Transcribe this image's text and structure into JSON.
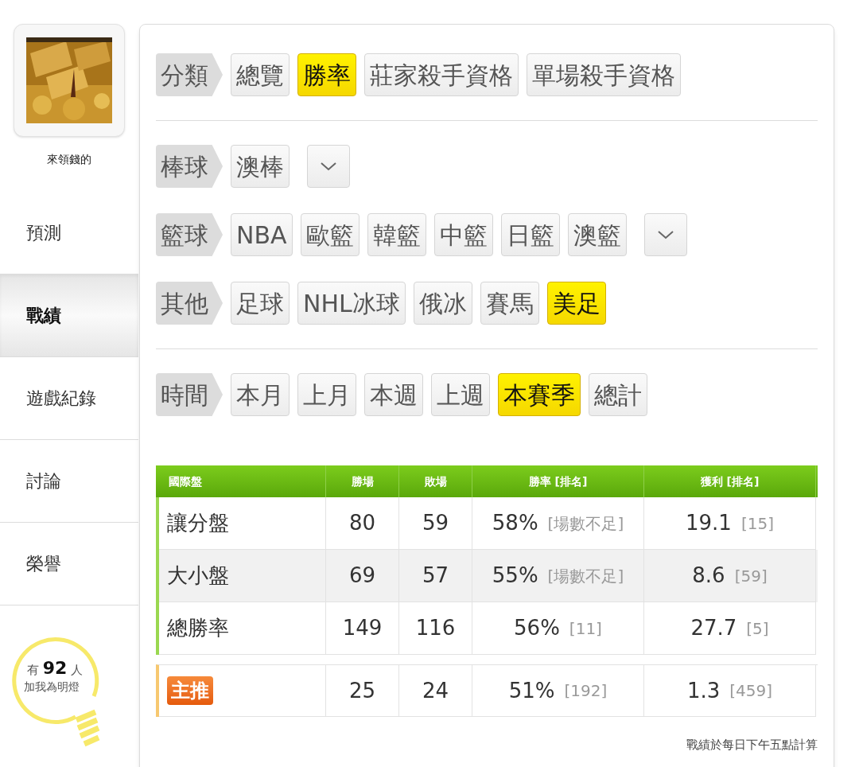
{
  "sidebar": {
    "profile_name": "來領錢的",
    "items": [
      {
        "label": "預測",
        "selected": false
      },
      {
        "label": "戰績",
        "selected": true
      },
      {
        "label": "遊戲紀錄",
        "selected": false
      },
      {
        "label": "討論",
        "selected": false
      },
      {
        "label": "榮譽",
        "selected": false
      }
    ],
    "fans": {
      "prefix": "有",
      "count": "92",
      "suffix": "人",
      "caption": "加我為明燈"
    }
  },
  "filters": [
    {
      "label": "分類",
      "divider_after": true,
      "has_more": false,
      "options": [
        {
          "label": "總覽",
          "selected": false
        },
        {
          "label": "勝率",
          "selected": true
        },
        {
          "label": "莊家殺手資格",
          "selected": false
        },
        {
          "label": "單場殺手資格",
          "selected": false
        }
      ]
    },
    {
      "label": "棒球",
      "divider_after": false,
      "has_more": true,
      "options": [
        {
          "label": "澳棒",
          "selected": false
        }
      ]
    },
    {
      "label": "籃球",
      "divider_after": false,
      "has_more": true,
      "options": [
        {
          "label": "NBA",
          "selected": false
        },
        {
          "label": "歐籃",
          "selected": false
        },
        {
          "label": "韓籃",
          "selected": false
        },
        {
          "label": "中籃",
          "selected": false
        },
        {
          "label": "日籃",
          "selected": false
        },
        {
          "label": "澳籃",
          "selected": false
        }
      ]
    },
    {
      "label": "其他",
      "divider_after": true,
      "has_more": false,
      "options": [
        {
          "label": "足球",
          "selected": false
        },
        {
          "label": "NHL冰球",
          "selected": false
        },
        {
          "label": "俄冰",
          "selected": false
        },
        {
          "label": "賽馬",
          "selected": false
        },
        {
          "label": "美足",
          "selected": true
        }
      ]
    },
    {
      "label": "時間",
      "divider_after": false,
      "has_more": false,
      "options": [
        {
          "label": "本月",
          "selected": false
        },
        {
          "label": "上月",
          "selected": false
        },
        {
          "label": "本週",
          "selected": false
        },
        {
          "label": "上週",
          "selected": false
        },
        {
          "label": "本賽季",
          "selected": true
        },
        {
          "label": "總計",
          "selected": false
        }
      ]
    }
  ],
  "table": {
    "columns": [
      "國際盤",
      "勝場",
      "敗場",
      "勝率 [排名]",
      "獲利 [排名]"
    ],
    "rows": [
      {
        "kind": "normal",
        "label": "讓分盤",
        "wins": "80",
        "losses": "59",
        "rate": "58%",
        "rate_rank": "[場數不足]",
        "profit": "19.1",
        "profit_rank": "[15]"
      },
      {
        "kind": "normal",
        "label": "大小盤",
        "wins": "69",
        "losses": "57",
        "rate": "55%",
        "rate_rank": "[場數不足]",
        "profit": "8.6",
        "profit_rank": "[59]"
      },
      {
        "kind": "normal",
        "label": "總勝率",
        "wins": "149",
        "losses": "116",
        "rate": "56%",
        "rate_rank": "[11]",
        "profit": "27.7",
        "profit_rank": "[5]"
      },
      {
        "kind": "featured",
        "label": "主推",
        "wins": "25",
        "losses": "24",
        "rate": "51%",
        "rate_rank": "[192]",
        "profit": "1.3",
        "profit_rank": "[459]"
      }
    ]
  },
  "footnote": "戰績於每日下午五點計算"
}
